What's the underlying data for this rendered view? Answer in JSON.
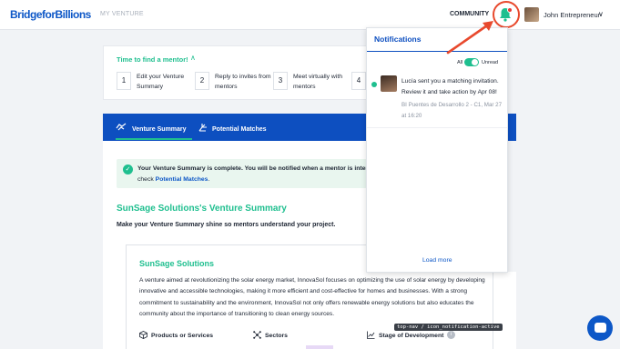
{
  "nav": {
    "logo": "BridgeforBillions",
    "my_venture": "MY VENTURE",
    "community": "COMMUNITY",
    "user_name": "John Entrepreneur"
  },
  "mentor": {
    "title": "Time to find a mentor!",
    "steps": [
      {
        "num": "1",
        "text": "Edit your Venture Summary"
      },
      {
        "num": "2",
        "text": "Reply to invites from mentors"
      },
      {
        "num": "3",
        "text": "Meet virtually with mentors"
      },
      {
        "num": "4",
        "text": ""
      }
    ]
  },
  "tabs": {
    "venture_summary": "Venture Summary",
    "potential_matches": "Potential Matches"
  },
  "alert": {
    "line1": "Your Venture Summary is complete. You will be notified when a mentor is intereste",
    "line2_prefix": "check ",
    "line2_link": "Potential Matches",
    "line2_suffix": "."
  },
  "summary": {
    "title": "SunSage Solutions's Venture Summary",
    "subtitle": "Make your Venture Summary shine so mentors understand your project."
  },
  "card": {
    "title": "SunSage Solutions",
    "description": "A venture aimed at revolutionizing the solar energy market, InnovaSol focuses on optimizing the use of solar energy by developing innovative and accessible technologies, making it more efficient and cost-effective for homes and businesses. With a strong commitment to sustainability and the environment, InnovaSol not only offers renewable energy solutions but also educates the community about the importance of transitioning to clean energy sources.",
    "products": "Products or Services",
    "sectors": "Sectors",
    "stage": "Stage of Development",
    "info_glyph": "i"
  },
  "tooltip": "top-nav / icon_notification-active",
  "notifications": {
    "title": "Notifications",
    "toggle_all": "All",
    "toggle_unread": "Unread",
    "toggle_on": true,
    "items": [
      {
        "text": "Lucía sent you a matching invitation. Review it and take action by Apr 08!",
        "meta": "BI Puentes de Desarrollo 2 - C1, Mar 27 at 16:20",
        "unread": true
      }
    ],
    "load_more": "Load more"
  },
  "colors": {
    "brand_blue": "#0d4fc0",
    "accent_green": "#1fbf8f",
    "badge_red": "#e53935",
    "annotation_red": "#e8492d"
  },
  "icons": [
    "bell-icon",
    "chevron-down-icon",
    "chevron-up-icon",
    "check-icon",
    "box-icon",
    "network-icon",
    "chart-icon",
    "info-icon",
    "chat-icon",
    "handshake-icon",
    "hand-icon"
  ]
}
